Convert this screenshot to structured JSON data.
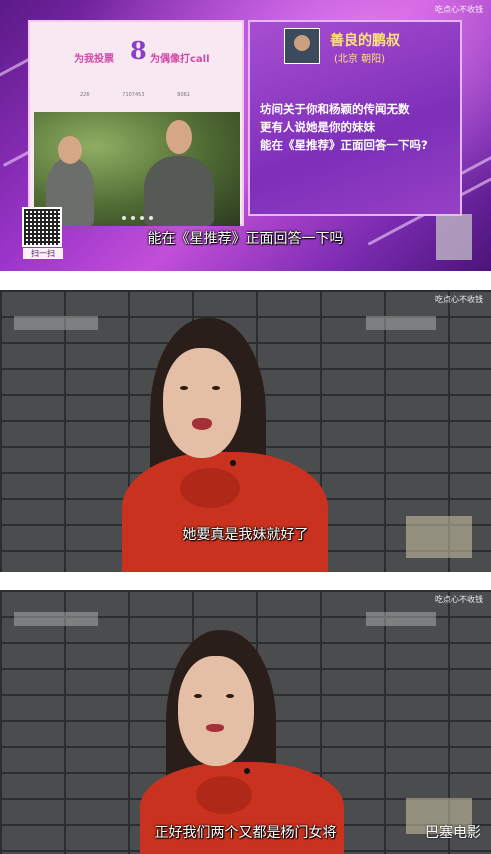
{
  "frame1": {
    "watermark": "吃点心不收钱",
    "rank_number": "8",
    "slogan_left": "为我投票",
    "slogan_right": "为偶像打call",
    "stats": [
      "226",
      "7107453",
      "8061"
    ],
    "sender_name": "善良的鹏叔",
    "sender_location": "(北京 朝阳)",
    "question_lines": [
      "坊间关于你和杨颖的传闻无数",
      "更有人说她是你的妹妹",
      "能在《星推荐》正面回答一下吗?"
    ],
    "qr_label": "扫一扫",
    "subtitle": "能在《星推荐》正面回答一下吗"
  },
  "frame2": {
    "watermark": "吃点心不收钱",
    "subtitle": "她要真是我妹就好了"
  },
  "frame3": {
    "watermark": "吃点心不收钱",
    "subtitle": "正好我们两个又都是杨门女将",
    "logo": "巴塞电影"
  }
}
